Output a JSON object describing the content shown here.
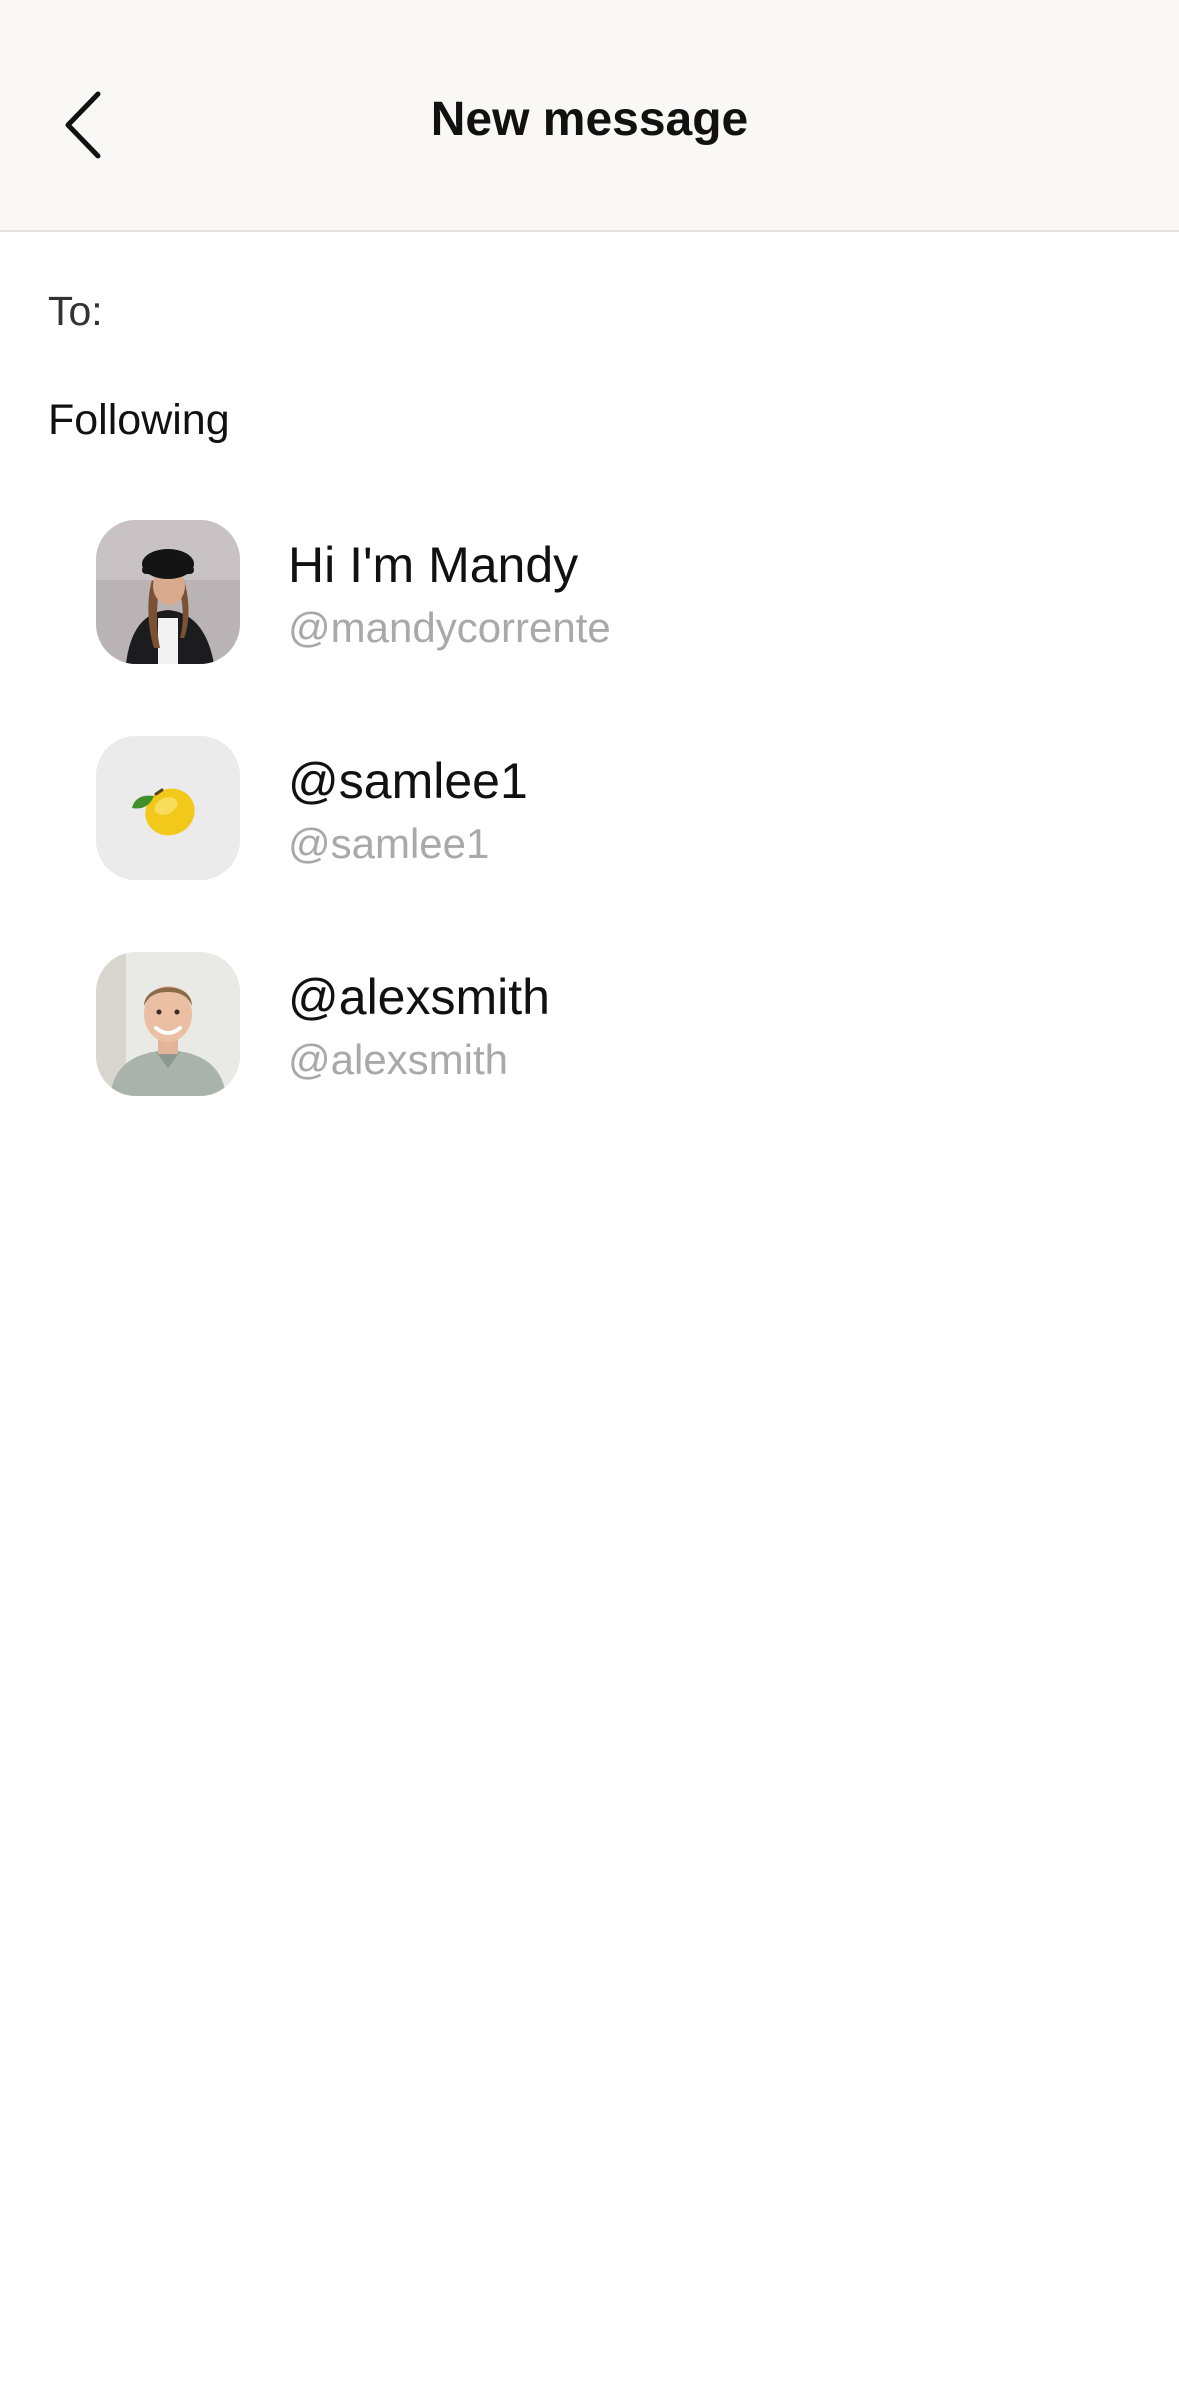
{
  "header": {
    "title": "New message",
    "back_icon": "chevron-left-icon"
  },
  "recipient": {
    "label": "To:",
    "value": "",
    "placeholder": ""
  },
  "following": {
    "section_title": "Following",
    "contacts": [
      {
        "name": "Hi I'm Mandy",
        "handle": "@mandycorrente",
        "avatar": "photo-woman-black-hat"
      },
      {
        "name": "@samlee1",
        "handle": "@samlee1",
        "avatar": "lemon-emoji"
      },
      {
        "name": "@alexsmith",
        "handle": "@alexsmith",
        "avatar": "photo-man-smiling"
      }
    ]
  },
  "colors": {
    "header_bg": "#f9f8f7",
    "handle_text": "#a9a9a9",
    "avatar_placeholder_bg": "#ebebeb"
  }
}
